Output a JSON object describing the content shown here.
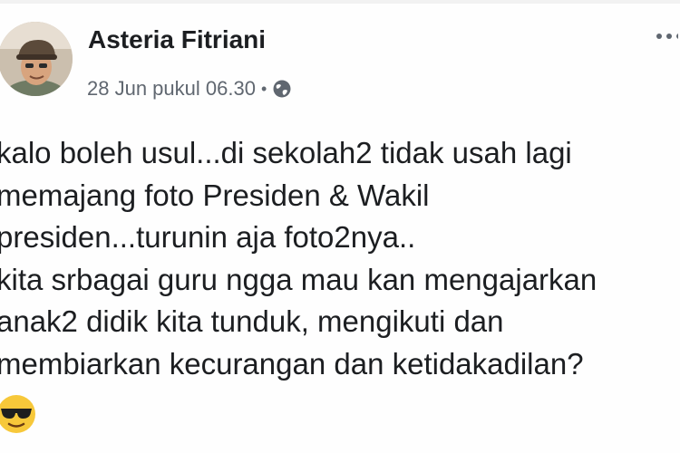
{
  "post": {
    "author": "Asteria Fitriani",
    "date": "28 Jun pukul 06.30",
    "separator": "•",
    "privacy_icon": "globe-icon",
    "options_icon": "more-dots-icon",
    "lines": [
      "kalo boleh usul...di sekolah2 tidak usah lagi",
      "memajang foto Presiden & Wakil",
      "presiden...turunin aja foto2nya..",
      "kita srbagai guru ngga mau kan mengajarkan",
      "anak2 didik kita tunduk, mengikuti dan",
      "membiarkan kecurangan dan ketidakadilan?"
    ],
    "emoji": "sunglasses-face-emoji"
  },
  "colors": {
    "text": "#1c1e21",
    "meta_text": "#606770",
    "background": "#ffffff"
  }
}
